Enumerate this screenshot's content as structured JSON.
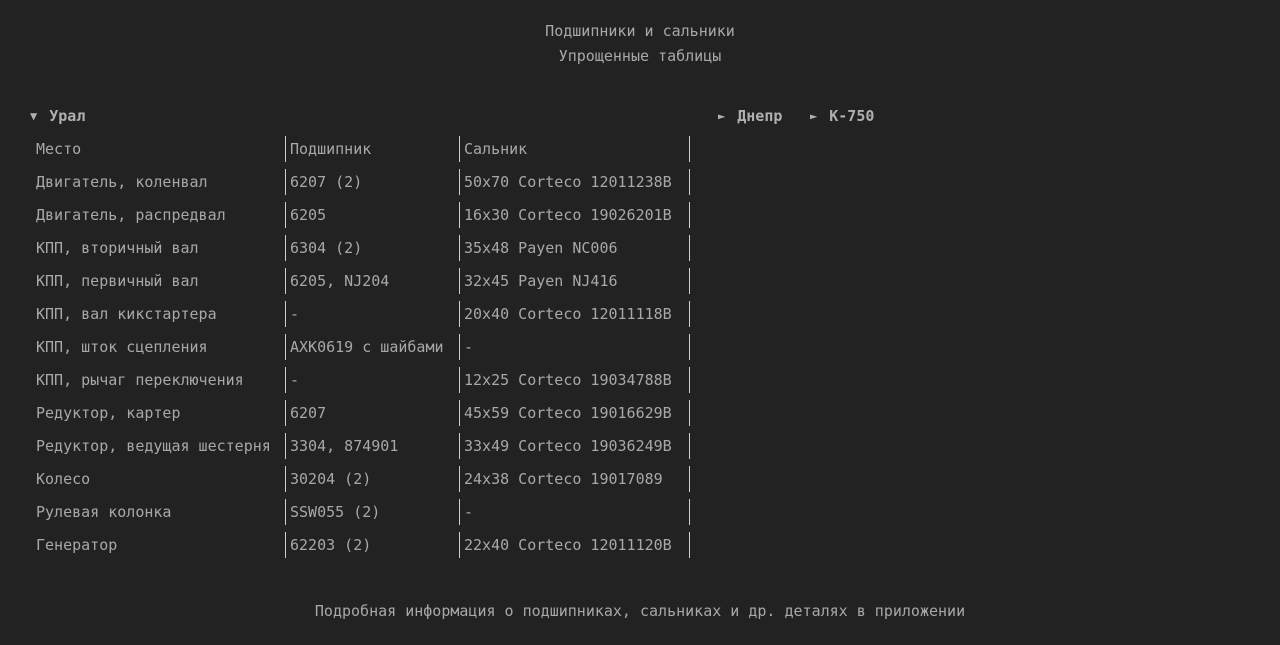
{
  "header": {
    "title": "Подшипники и сальники",
    "subtitle": "Упрощенные таблицы"
  },
  "sections": {
    "ural": {
      "arrow": "▼",
      "label": "Урал"
    },
    "dnepr": {
      "arrow": "►",
      "label": "Днепр"
    },
    "k750": {
      "arrow": "►",
      "label": "К-750"
    }
  },
  "table": {
    "columns": [
      "Место",
      "Подшипник",
      "Сальник"
    ],
    "rows": [
      [
        "Двигатель, коленвал",
        "6207 (2)",
        "50x70 Corteco 12011238B"
      ],
      [
        "Двигатель, распредвал",
        "6205",
        "16x30 Corteco 19026201B"
      ],
      [
        "КПП, вторичный вал",
        "6304 (2)",
        "35x48 Payen NC006"
      ],
      [
        "КПП, первичный вал",
        "6205, NJ204",
        "32x45 Payen NJ416"
      ],
      [
        "КПП, вал кикстартера",
        "-",
        "20x40 Corteco 12011118B"
      ],
      [
        "КПП, шток сцепления",
        "AXK0619 с шайбами",
        "-"
      ],
      [
        "КПП, рычаг переключения",
        "-",
        "12x25 Corteco 19034788B"
      ],
      [
        "Редуктор, картер",
        "6207",
        "45x59 Corteco 19016629B"
      ],
      [
        "Редуктор, ведущая шестерня",
        "3304, 874901",
        "33x49 Corteco 19036249B"
      ],
      [
        "Колесо",
        "30204 (2)",
        "24x38 Corteco 19017089"
      ],
      [
        "Рулевая колонка",
        "SSW055 (2)",
        "-"
      ],
      [
        "Генератор",
        "62203 (2)",
        "22x40 Corteco 12011120B"
      ]
    ]
  },
  "footer": {
    "text": "Подробная информация о подшипниках, сальниках и др. деталях в приложении"
  }
}
